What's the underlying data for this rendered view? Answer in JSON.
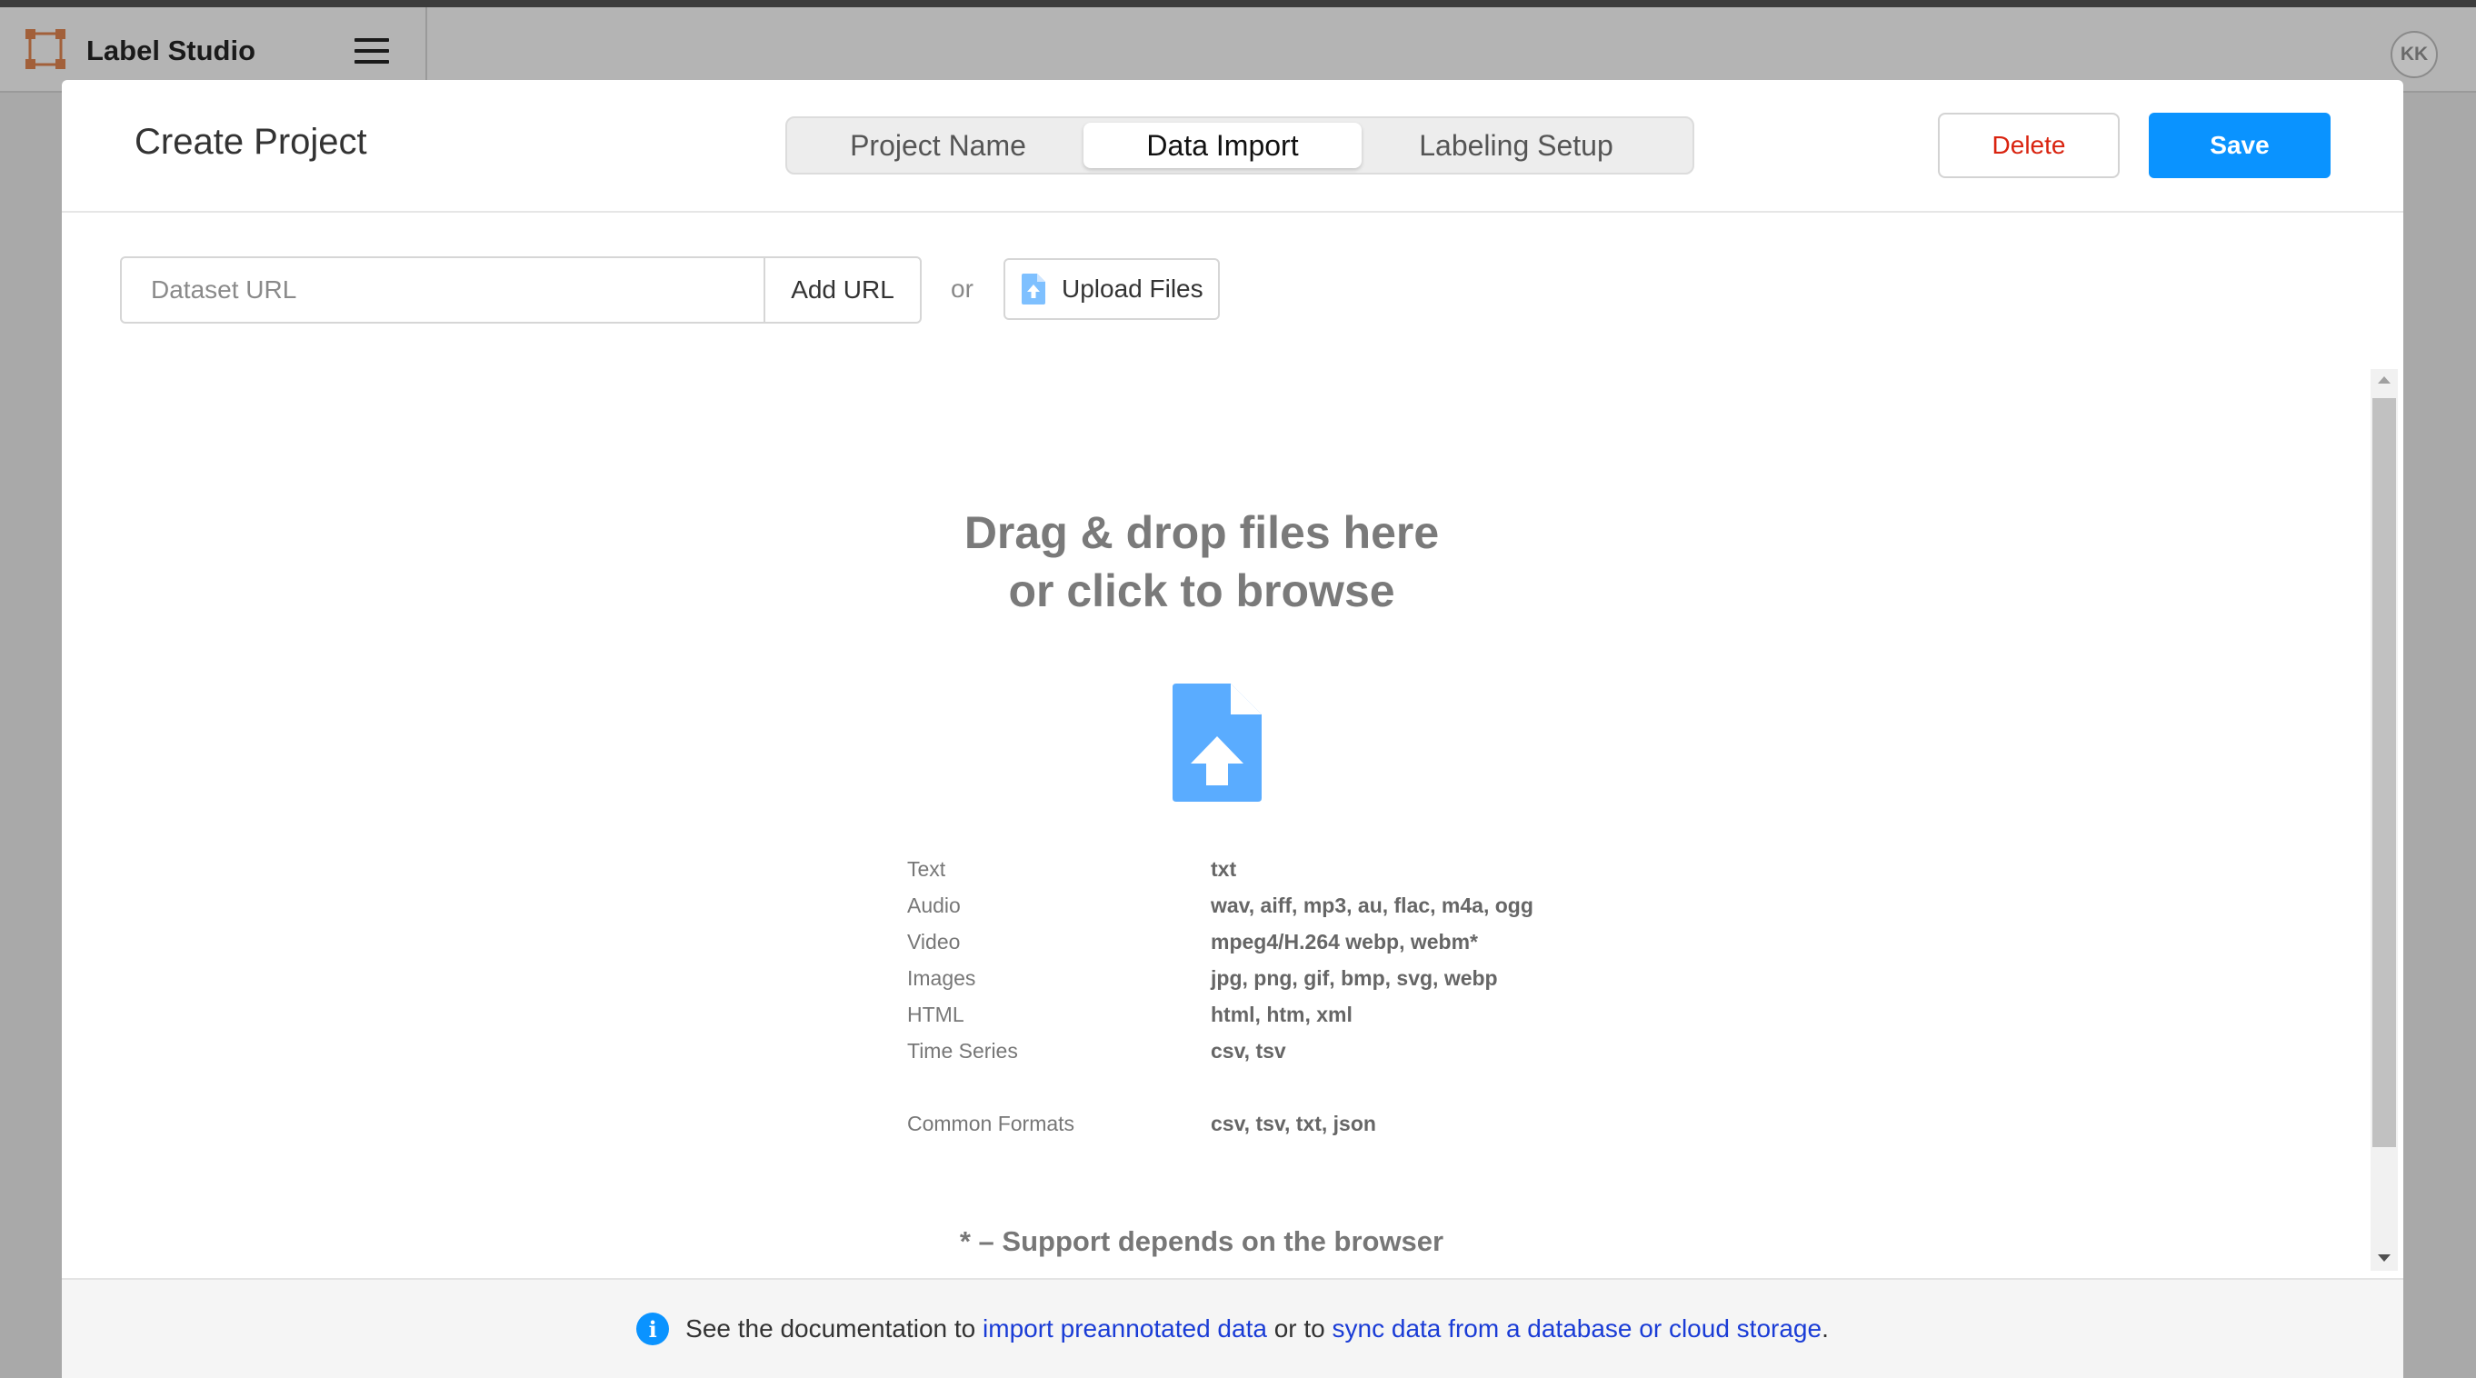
{
  "app": {
    "title": "Label Studio",
    "user_initials": "KK"
  },
  "modal": {
    "title": "Create Project",
    "tabs": [
      {
        "label": "Project Name",
        "active": false
      },
      {
        "label": "Data Import",
        "active": true
      },
      {
        "label": "Labeling Setup",
        "active": false
      }
    ],
    "delete_label": "Delete",
    "save_label": "Save"
  },
  "import": {
    "url_placeholder": "Dataset URL",
    "add_url_label": "Add URL",
    "or_label": "or",
    "upload_label": "Upload Files"
  },
  "dropzone": {
    "line1": "Drag & drop files here",
    "line2": "or click to browse",
    "formats": [
      {
        "label": "Text",
        "value": "txt"
      },
      {
        "label": "Audio",
        "value": "wav, aiff, mp3, au, flac, m4a, ogg"
      },
      {
        "label": "Video",
        "value": "mpeg4/H.264 webp, webm*"
      },
      {
        "label": "Images",
        "value": "jpg, png, gif, bmp, svg, webp"
      },
      {
        "label": "HTML",
        "value": "html, htm, xml"
      },
      {
        "label": "Time Series",
        "value": "csv, tsv"
      }
    ],
    "common": {
      "label": "Common Formats",
      "value": "csv, tsv, txt, json"
    },
    "footnote": "* – Support depends on the browser"
  },
  "footer": {
    "prefix": "See the documentation to ",
    "link1": "import preannotated data",
    "middle": " or to ",
    "link2": "sync data from a database or cloud storage",
    "suffix": "."
  },
  "colors": {
    "accent": "#0a93ff",
    "danger": "#d9230f",
    "link": "#1a3cd6",
    "logo": "#c0651f"
  },
  "icons": {
    "logo": "label-studio-logo-icon",
    "menu": "hamburger-menu-icon",
    "upload": "file-upload-icon",
    "info": "info-icon"
  }
}
